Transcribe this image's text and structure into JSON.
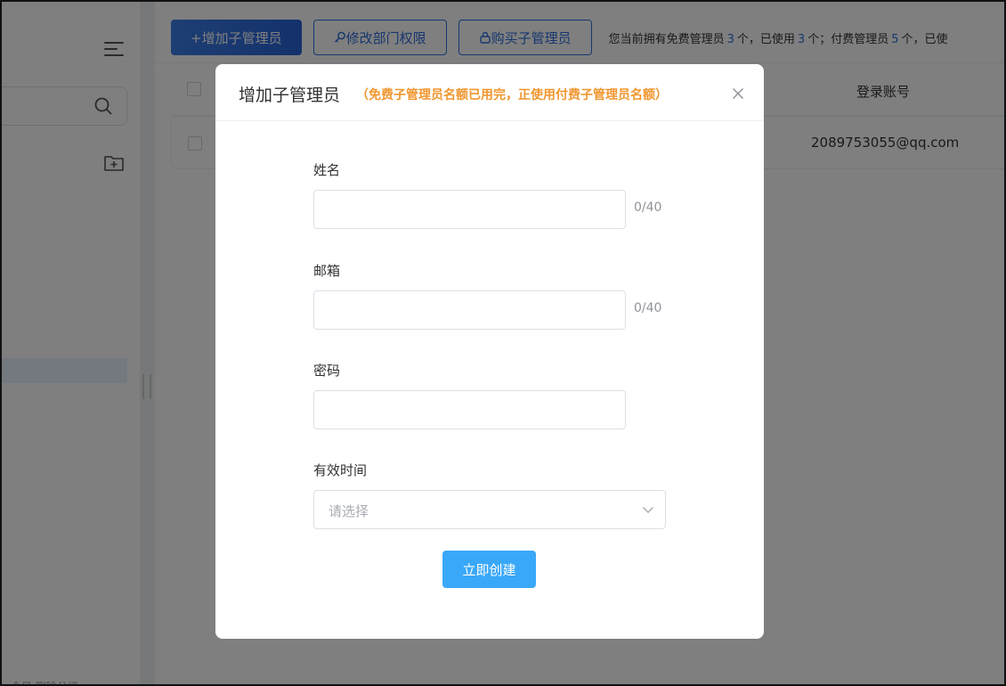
{
  "toolbar": {
    "add_label": "+增加子管理员",
    "edit_label": "修改部门权限",
    "buy_label": "购买子管理员",
    "quota": {
      "prefix": "您当前拥有免费管理员",
      "free_count": "3",
      "mid1": "个，已使用",
      "used_count": "3",
      "mid2": "个；付费管理员",
      "paid_count": "5",
      "suffix": "个，已使"
    }
  },
  "table": {
    "column_login": "登录账号",
    "rows": [
      {
        "email": "2089753055@qq.com"
      }
    ]
  },
  "sidebar": {
    "footer_text": "全见  删除分组"
  },
  "modal": {
    "title": "增加子管理员",
    "note": "（免费子管理员名额已用完，正使用付费子管理员名额）",
    "fields": {
      "name": {
        "label": "姓名",
        "value": "",
        "counter": "0/40"
      },
      "email": {
        "label": "邮箱",
        "value": "",
        "counter": "0/40"
      },
      "password": {
        "label": "密码",
        "value": ""
      },
      "validity": {
        "label": "有效时间",
        "placeholder": "请选择"
      }
    },
    "submit_label": "立即创建"
  },
  "colors": {
    "primary": "#2f6fde",
    "note_orange": "#f0962e",
    "submit_blue": "#3aa8f8"
  },
  "icons": [
    "menu-icon",
    "search-icon",
    "folder-add-icon",
    "key-icon",
    "lock-icon",
    "close-icon",
    "chevron-down-icon"
  ]
}
